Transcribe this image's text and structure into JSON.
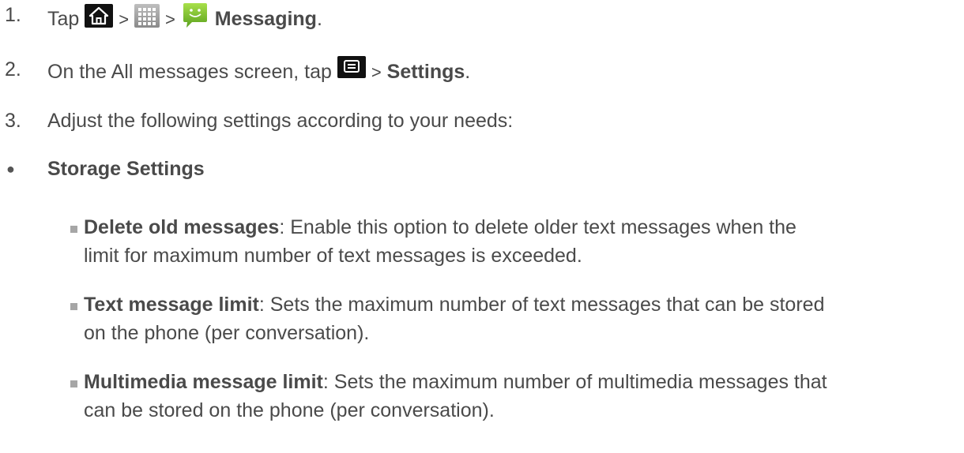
{
  "steps": [
    {
      "num": "1.",
      "tap": "Tap",
      "sep1": ">",
      "sep2": ">",
      "app": "Messaging",
      "end": ".",
      "icons": [
        "home-icon",
        "apps-grid-icon",
        "messaging-app-icon"
      ]
    },
    {
      "num": "2.",
      "pre": "On the All messages screen, tap",
      "sep": ">",
      "target": "Settings",
      "end": ".",
      "icons": [
        "menu-icon"
      ]
    },
    {
      "num": "3.",
      "text": "Adjust the following settings according to your needs:"
    }
  ],
  "section": {
    "bullet": "●",
    "title": "Storage Settings"
  },
  "options": [
    {
      "bullet": "▪",
      "name": "Delete old messages",
      "line1": ": Enable this option to delete older text messages when the",
      "line2": "limit for maximum number of text messages is exceeded."
    },
    {
      "bullet": "▪",
      "name": "Text message limit",
      "line1": ": Sets the maximum number of text messages that can be stored",
      "line2": "on the phone (per conversation)."
    },
    {
      "bullet": "▪",
      "name": "Multimedia message limit",
      "line1": ": Sets the maximum number of multimedia messages that",
      "line2": "can be stored on the phone (per conversation)."
    }
  ]
}
